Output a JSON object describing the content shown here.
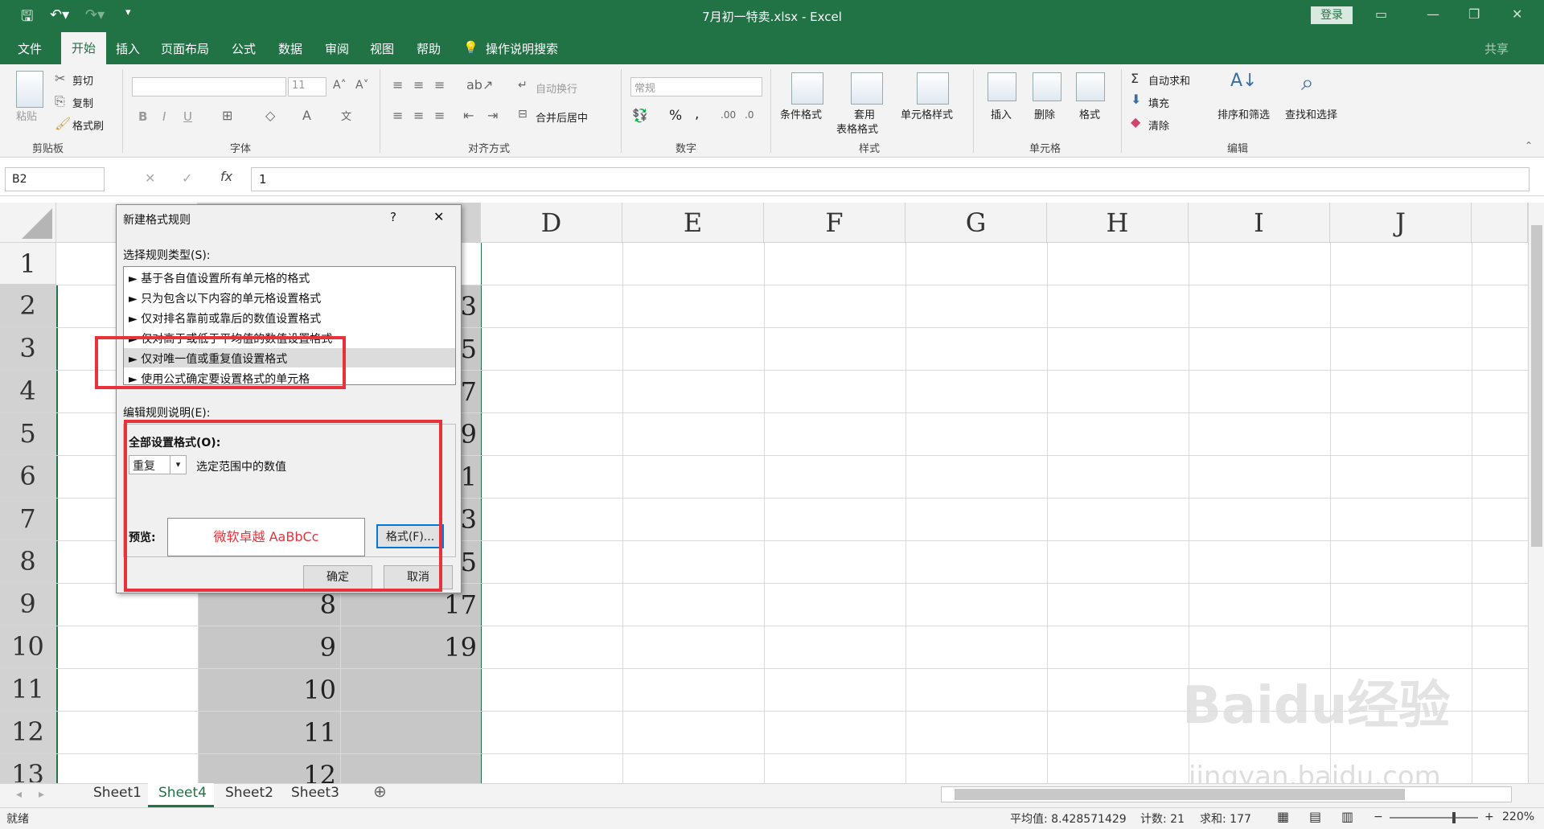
{
  "titlebar": {
    "title": "7月初一特卖.xlsx  -  Excel",
    "login": "登录",
    "save_icon": "save-icon",
    "undo_icon": "undo-icon",
    "redo_icon": "redo-icon",
    "customize_icon": "customize-qa-icon"
  },
  "ribbon_tabs": [
    "文件",
    "开始",
    "插入",
    "页面布局",
    "公式",
    "数据",
    "审阅",
    "视图",
    "帮助",
    "操作说明搜索"
  ],
  "share": "共享",
  "clipboard": {
    "paste": "粘贴",
    "cut": "剪切",
    "copy": "复制",
    "format_painter": "格式刷",
    "label": "剪贴板"
  },
  "font": {
    "size": "11",
    "bold": "B",
    "italic": "I",
    "underline": "U",
    "label": "字体"
  },
  "alignment": {
    "wrap": "自动换行",
    "merge": "合并后居中",
    "label": "对齐方式"
  },
  "number": {
    "format": "常规",
    "percent": "%",
    "comma": ",",
    "label": "数字"
  },
  "styles": {
    "conditional": "条件格式",
    "table_1": "套用",
    "table_2": "表格格式",
    "cell_styles": "单元格样式",
    "label": "样式"
  },
  "cells": {
    "insert": "插入",
    "delete": "删除",
    "format": "格式",
    "label": "单元格"
  },
  "editing": {
    "autosum": "自动求和",
    "fill": "填充",
    "clear": "清除",
    "sort": "排序和筛选",
    "find": "查找和选择",
    "label": "编辑"
  },
  "formula_bar": {
    "name_box": "B2",
    "value": "1",
    "fx": "fx"
  },
  "columns": [
    "D",
    "E",
    "F",
    "G",
    "H",
    "I",
    "J"
  ],
  "rows": [
    "1",
    "2",
    "3",
    "4",
    "5",
    "6",
    "7",
    "8",
    "9",
    "10",
    "11",
    "12",
    "13"
  ],
  "visible_cells": {
    "C2": "3",
    "C3": "5",
    "C4": "7",
    "C5": "9",
    "C6": "1",
    "C7": "3",
    "C8": "5",
    "B9": "8",
    "C9": "17",
    "B10": "9",
    "C10": "19",
    "B11": "10",
    "B12": "11",
    "B13": "12"
  },
  "dialog": {
    "title": "新建格式规则",
    "help": "?",
    "close": "✕",
    "select_type_label": "选择规则类型(S):",
    "rule_types": [
      "► 基于各自值设置所有单元格的格式",
      "► 只为包含以下内容的单元格设置格式",
      "► 仅对排名靠前或靠后的数值设置格式",
      "► 仅对高于或低于平均值的数值设置格式",
      "► 仅对唯一值或重复值设置格式",
      "► 使用公式确定要设置格式的单元格"
    ],
    "edit_label": "编辑规则说明(E):",
    "format_all_label": "全部设置格式(O):",
    "dup_value": "重复",
    "dup_suffix": "选定范围中的数值",
    "preview_label": "预览:",
    "preview_text": "微软卓越  AaBbCc",
    "format_button": "格式(F)...",
    "ok": "确定",
    "cancel": "取消"
  },
  "sheets": [
    "Sheet1",
    "Sheet4",
    "Sheet2",
    "Sheet3"
  ],
  "active_sheet": "Sheet4",
  "status": {
    "ready": "就绪",
    "average": "平均值: 8.428571429",
    "count": "计数: 21",
    "sum": "求和: 177",
    "zoom": "220%"
  },
  "watermark": {
    "main": "Baidu经验",
    "sub": "jingyan.baidu.com"
  },
  "colors": {
    "excel_green": "#217346",
    "highlight_red": "#e8313b",
    "selection": "#c7c7c7"
  }
}
